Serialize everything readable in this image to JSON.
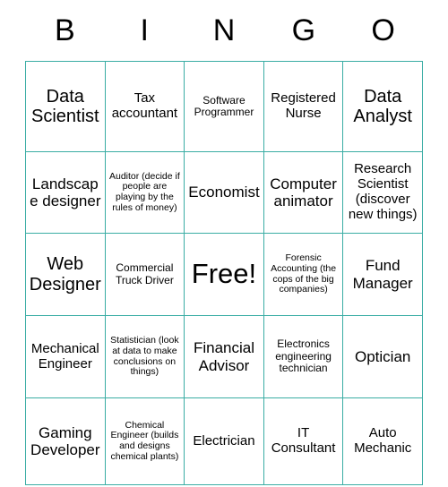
{
  "card": {
    "header_letters": [
      "B",
      "I",
      "N",
      "G",
      "O"
    ],
    "accent_color": "#3aada4",
    "text_color": "#000000",
    "background_color": "#ffffff",
    "rows": [
      [
        {
          "text": "Data Scientist",
          "size": "xl"
        },
        {
          "text": "Tax accountant",
          "size": "md"
        },
        {
          "text": "Software Programmer",
          "size": "sm"
        },
        {
          "text": "Registered Nurse",
          "size": "md"
        },
        {
          "text": "Data Analyst",
          "size": "xl"
        }
      ],
      [
        {
          "text": "Landscape designer",
          "size": "lg"
        },
        {
          "text": "Auditor (decide if people are playing by the rules of money)",
          "size": "xs"
        },
        {
          "text": "Economist",
          "size": "lg"
        },
        {
          "text": "Computer animator",
          "size": "lg"
        },
        {
          "text": "Research Scientist (discover new things)",
          "size": "md"
        }
      ],
      [
        {
          "text": "Web Designer",
          "size": "xl"
        },
        {
          "text": "Commercial Truck Driver",
          "size": "sm"
        },
        {
          "text": "Free!",
          "size": "free"
        },
        {
          "text": "Forensic Accounting (the cops of the big companies)",
          "size": "xs"
        },
        {
          "text": "Fund Manager",
          "size": "lg"
        }
      ],
      [
        {
          "text": "Mechanical Engineer",
          "size": "md"
        },
        {
          "text": "Statistician (look at data to make conclusions on things)",
          "size": "xs"
        },
        {
          "text": "Financial Advisor",
          "size": "lg"
        },
        {
          "text": "Electronics engineering technician",
          "size": "sm"
        },
        {
          "text": "Optician",
          "size": "lg"
        }
      ],
      [
        {
          "text": "Gaming Developer",
          "size": "lg"
        },
        {
          "text": "Chemical Engineer (builds and designs chemical plants)",
          "size": "xs"
        },
        {
          "text": "Electrician",
          "size": "md"
        },
        {
          "text": "IT Consultant",
          "size": "md"
        },
        {
          "text": "Auto Mechanic",
          "size": "md"
        }
      ]
    ]
  }
}
